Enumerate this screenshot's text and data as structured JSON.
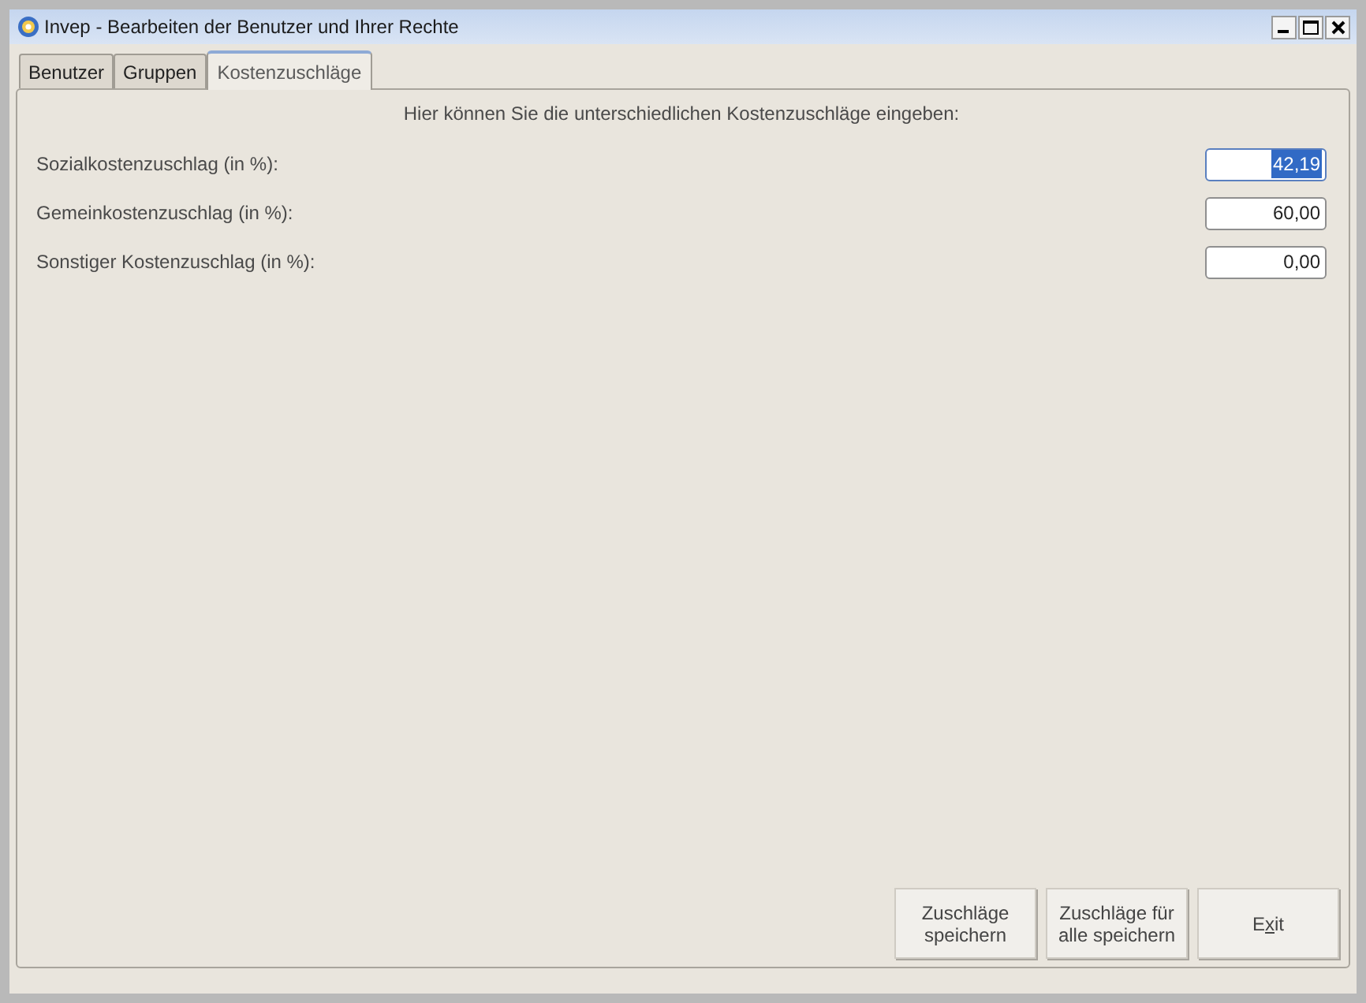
{
  "window": {
    "title": "Invep - Bearbeiten der Benutzer und Ihrer Rechte"
  },
  "tabs": [
    {
      "label": "Benutzer",
      "selected": false
    },
    {
      "label": "Gruppen",
      "selected": false
    },
    {
      "label": "Kostenzuschläge",
      "selected": true
    }
  ],
  "panel": {
    "heading": "Hier können Sie die unterschiedlichen Kostenzuschläge eingeben:",
    "fields": [
      {
        "label": "Sozialkostenzuschlag (in %):",
        "value": "42,19",
        "focused": true
      },
      {
        "label": "Gemeinkostenzuschlag (in %):",
        "value": "60,00",
        "focused": false
      },
      {
        "label": "Sonstiger Kostenzuschlag (in %):",
        "value": "0,00",
        "focused": false
      }
    ]
  },
  "buttons": [
    {
      "kind": "lines",
      "lines": [
        "Zuschläge",
        "speichern"
      ]
    },
    {
      "kind": "lines",
      "lines": [
        "Zuschläge für",
        "alle speichern"
      ]
    },
    {
      "kind": "mnemonic",
      "before": "E",
      "key": "x",
      "after": "it"
    }
  ]
}
